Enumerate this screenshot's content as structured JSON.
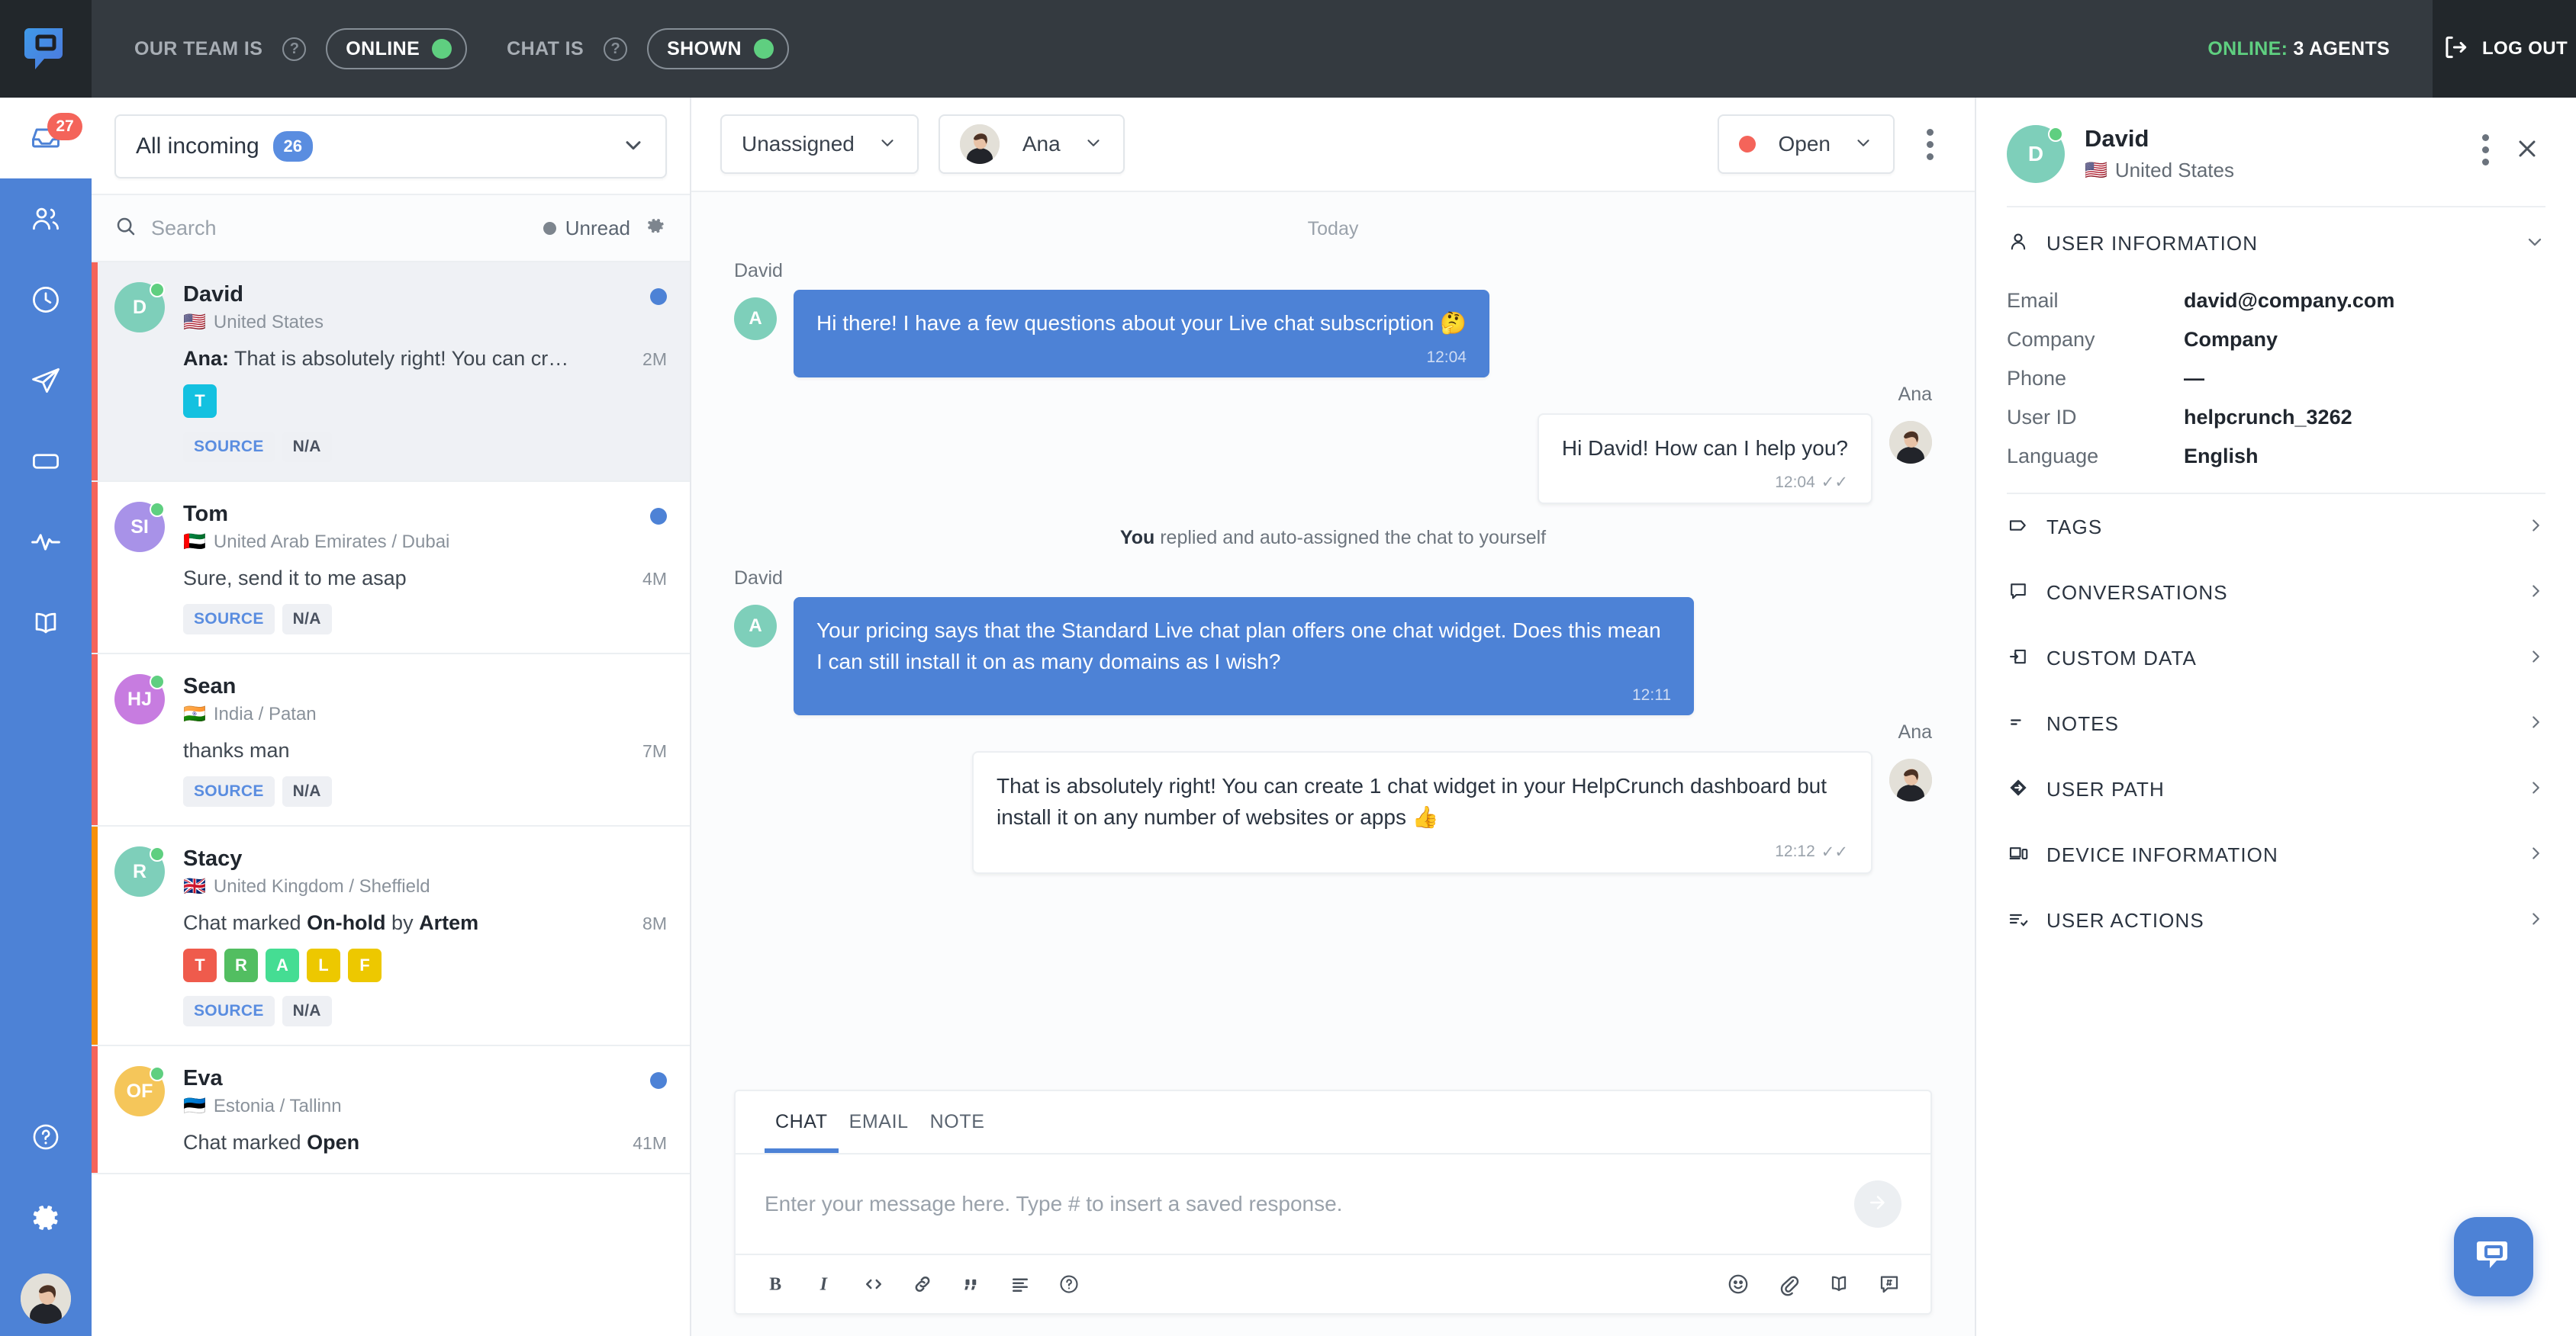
{
  "topbar": {
    "team_status_label": "OUR TEAM IS",
    "team_status_value": "ONLINE",
    "chat_status_label": "CHAT IS",
    "chat_status_value": "SHOWN",
    "online_prefix": "ONLINE:",
    "online_count": " 3 AGENTS",
    "logout_label": "LOG OUT",
    "accent_green": "#5fcf80",
    "bar_color": "#343a40"
  },
  "leftnav": {
    "inbox_badge": "27",
    "items": [
      {
        "name": "inbox",
        "active": true
      },
      {
        "name": "contacts",
        "active": false
      },
      {
        "name": "history",
        "active": false
      },
      {
        "name": "campaigns",
        "active": false
      },
      {
        "name": "popups",
        "active": false
      },
      {
        "name": "reports",
        "active": false
      },
      {
        "name": "knowledge-base",
        "active": false
      }
    ],
    "accent": "#4d82d6"
  },
  "conversations": {
    "filter_label": "All incoming",
    "filter_count": "26",
    "search_placeholder": "Search",
    "search_value": "",
    "unread_label": "Unread",
    "items": [
      {
        "name": "David",
        "initials": "D",
        "avatar_color": "#7ecfba",
        "flag": "🇺🇸",
        "location": "United States",
        "preview_prefix": "Ana:",
        "preview": " That is absolutely right! You can cr…",
        "time": "2M",
        "unread": true,
        "status_color": "#f4645a",
        "selected": true,
        "tags": [
          {
            "letter": "T",
            "color": "#14c1e0"
          }
        ],
        "meta": [
          {
            "text": "SOURCE",
            "blue": true
          },
          {
            "text": "N/A",
            "blue": false
          }
        ]
      },
      {
        "name": "Tom",
        "initials": "SI",
        "avatar_color": "#a892e8",
        "flag": "🇦🇪",
        "location": "United Arab Emirates / Dubai",
        "preview_prefix": "",
        "preview": "Sure, send it to me asap",
        "time": "4M",
        "unread": true,
        "status_color": "#f4645a",
        "selected": false,
        "tags": [],
        "meta": [
          {
            "text": "SOURCE",
            "blue": true
          },
          {
            "text": "N/A",
            "blue": false
          }
        ]
      },
      {
        "name": "Sean",
        "initials": "HJ",
        "avatar_color": "#c77ce0",
        "flag": "🇮🇳",
        "location": "India / Patan",
        "preview_prefix": "",
        "preview": "thanks man",
        "time": "7M",
        "unread": false,
        "status_color": "#f4645a",
        "selected": false,
        "tags": [],
        "meta": [
          {
            "text": "SOURCE",
            "blue": true
          },
          {
            "text": "N/A",
            "blue": false
          }
        ]
      },
      {
        "name": "Stacy",
        "initials": "R",
        "avatar_color": "#7ecfba",
        "flag": "🇬🇧",
        "location": "United Kingdom / Sheffield",
        "preview_prefix": "",
        "preview": "Chat marked <b>On-hold</b> by <b>Artem</b>",
        "time": "8M",
        "unread": false,
        "status_color": "#f79009",
        "selected": false,
        "tags": [
          {
            "letter": "T",
            "color": "#ef5b4c"
          },
          {
            "letter": "R",
            "color": "#52be61"
          },
          {
            "letter": "A",
            "color": "#45dd93"
          },
          {
            "letter": "L",
            "color": "#edc800"
          },
          {
            "letter": "F",
            "color": "#edc800"
          }
        ],
        "meta": [
          {
            "text": "SOURCE",
            "blue": true
          },
          {
            "text": "N/A",
            "blue": false
          }
        ]
      },
      {
        "name": "Eva",
        "initials": "OF",
        "avatar_color": "#f5c65a",
        "flag": "🇪🇪",
        "location": "Estonia / Tallinn",
        "preview_prefix": "",
        "preview": "Chat marked <b>Open</b>",
        "time": "41M",
        "unread": true,
        "status_color": "#f4645a",
        "selected": false,
        "tags": [],
        "meta": []
      }
    ]
  },
  "chat": {
    "assignee_label": "Unassigned",
    "agent_label": "Ana",
    "status_label": "Open",
    "status_color": "#f4645a",
    "day_separator": "Today",
    "system_note_bold": "You",
    "system_note_rest": " replied and auto-assigned the chat to yourself",
    "messages": [
      {
        "sender": "David",
        "side": "in",
        "avatar_initial": "A",
        "avatar_color": "#7ecfba",
        "text": "Hi there! I have a few questions about your Live chat subscription 🤔",
        "time": "12:04",
        "read_receipt": false
      },
      {
        "sender": "Ana",
        "side": "out",
        "avatar_initial": "",
        "avatar_color": "",
        "text": "Hi David! How can I help you?",
        "time": "12:04",
        "read_receipt": true
      },
      {
        "sender": "David",
        "side": "in",
        "avatar_initial": "A",
        "avatar_color": "#7ecfba",
        "text": "Your pricing says that the Standard Live chat plan offers one chat widget. Does this mean I can still install it on as many domains as I wish?",
        "time": "12:11",
        "read_receipt": false
      },
      {
        "sender": "Ana",
        "side": "out",
        "avatar_initial": "",
        "avatar_color": "",
        "text": "That is absolutely right! You can create 1 chat widget in your HelpCrunch dashboard but install it on any number of websites or apps 👍",
        "time": "12:12",
        "read_receipt": true
      }
    ]
  },
  "composer": {
    "tabs": [
      {
        "label": "CHAT",
        "active": true
      },
      {
        "label": "EMAIL",
        "active": false
      },
      {
        "label": "NOTE",
        "active": false
      }
    ],
    "placeholder": "Enter your message here. Type # to insert a saved response.",
    "value": "",
    "tools_left": [
      "bold-icon",
      "italic-icon",
      "code-icon",
      "link-icon",
      "quote-icon",
      "list-icon",
      "help-icon"
    ],
    "tools_right": [
      "emoji-icon",
      "attachment-icon",
      "knowledge-base-icon",
      "saved-response-icon"
    ]
  },
  "rightpanel": {
    "user_name": "David",
    "user_initials": "D",
    "user_avatar_color": "#7ecfba",
    "user_flag": "🇺🇸",
    "user_location": "United States",
    "user_info_title": "USER INFORMATION",
    "fields": [
      {
        "label": "Email",
        "value": "david@company.com"
      },
      {
        "label": "Company",
        "value": "Company"
      },
      {
        "label": "Phone",
        "value": "—"
      },
      {
        "label": "User ID",
        "value": "helpcrunch_3262"
      },
      {
        "label": "Language",
        "value": "English"
      }
    ],
    "sections": [
      {
        "label": "TAGS",
        "icon": "tag-icon"
      },
      {
        "label": "CONVERSATIONS",
        "icon": "chat-bubble-icon"
      },
      {
        "label": "CUSTOM DATA",
        "icon": "custom-data-icon"
      },
      {
        "label": "NOTES",
        "icon": "notes-icon"
      },
      {
        "label": "USER PATH",
        "icon": "user-path-icon"
      },
      {
        "label": "DEVICE INFORMATION",
        "icon": "device-icon"
      },
      {
        "label": "USER ACTIONS",
        "icon": "user-actions-icon"
      }
    ]
  }
}
